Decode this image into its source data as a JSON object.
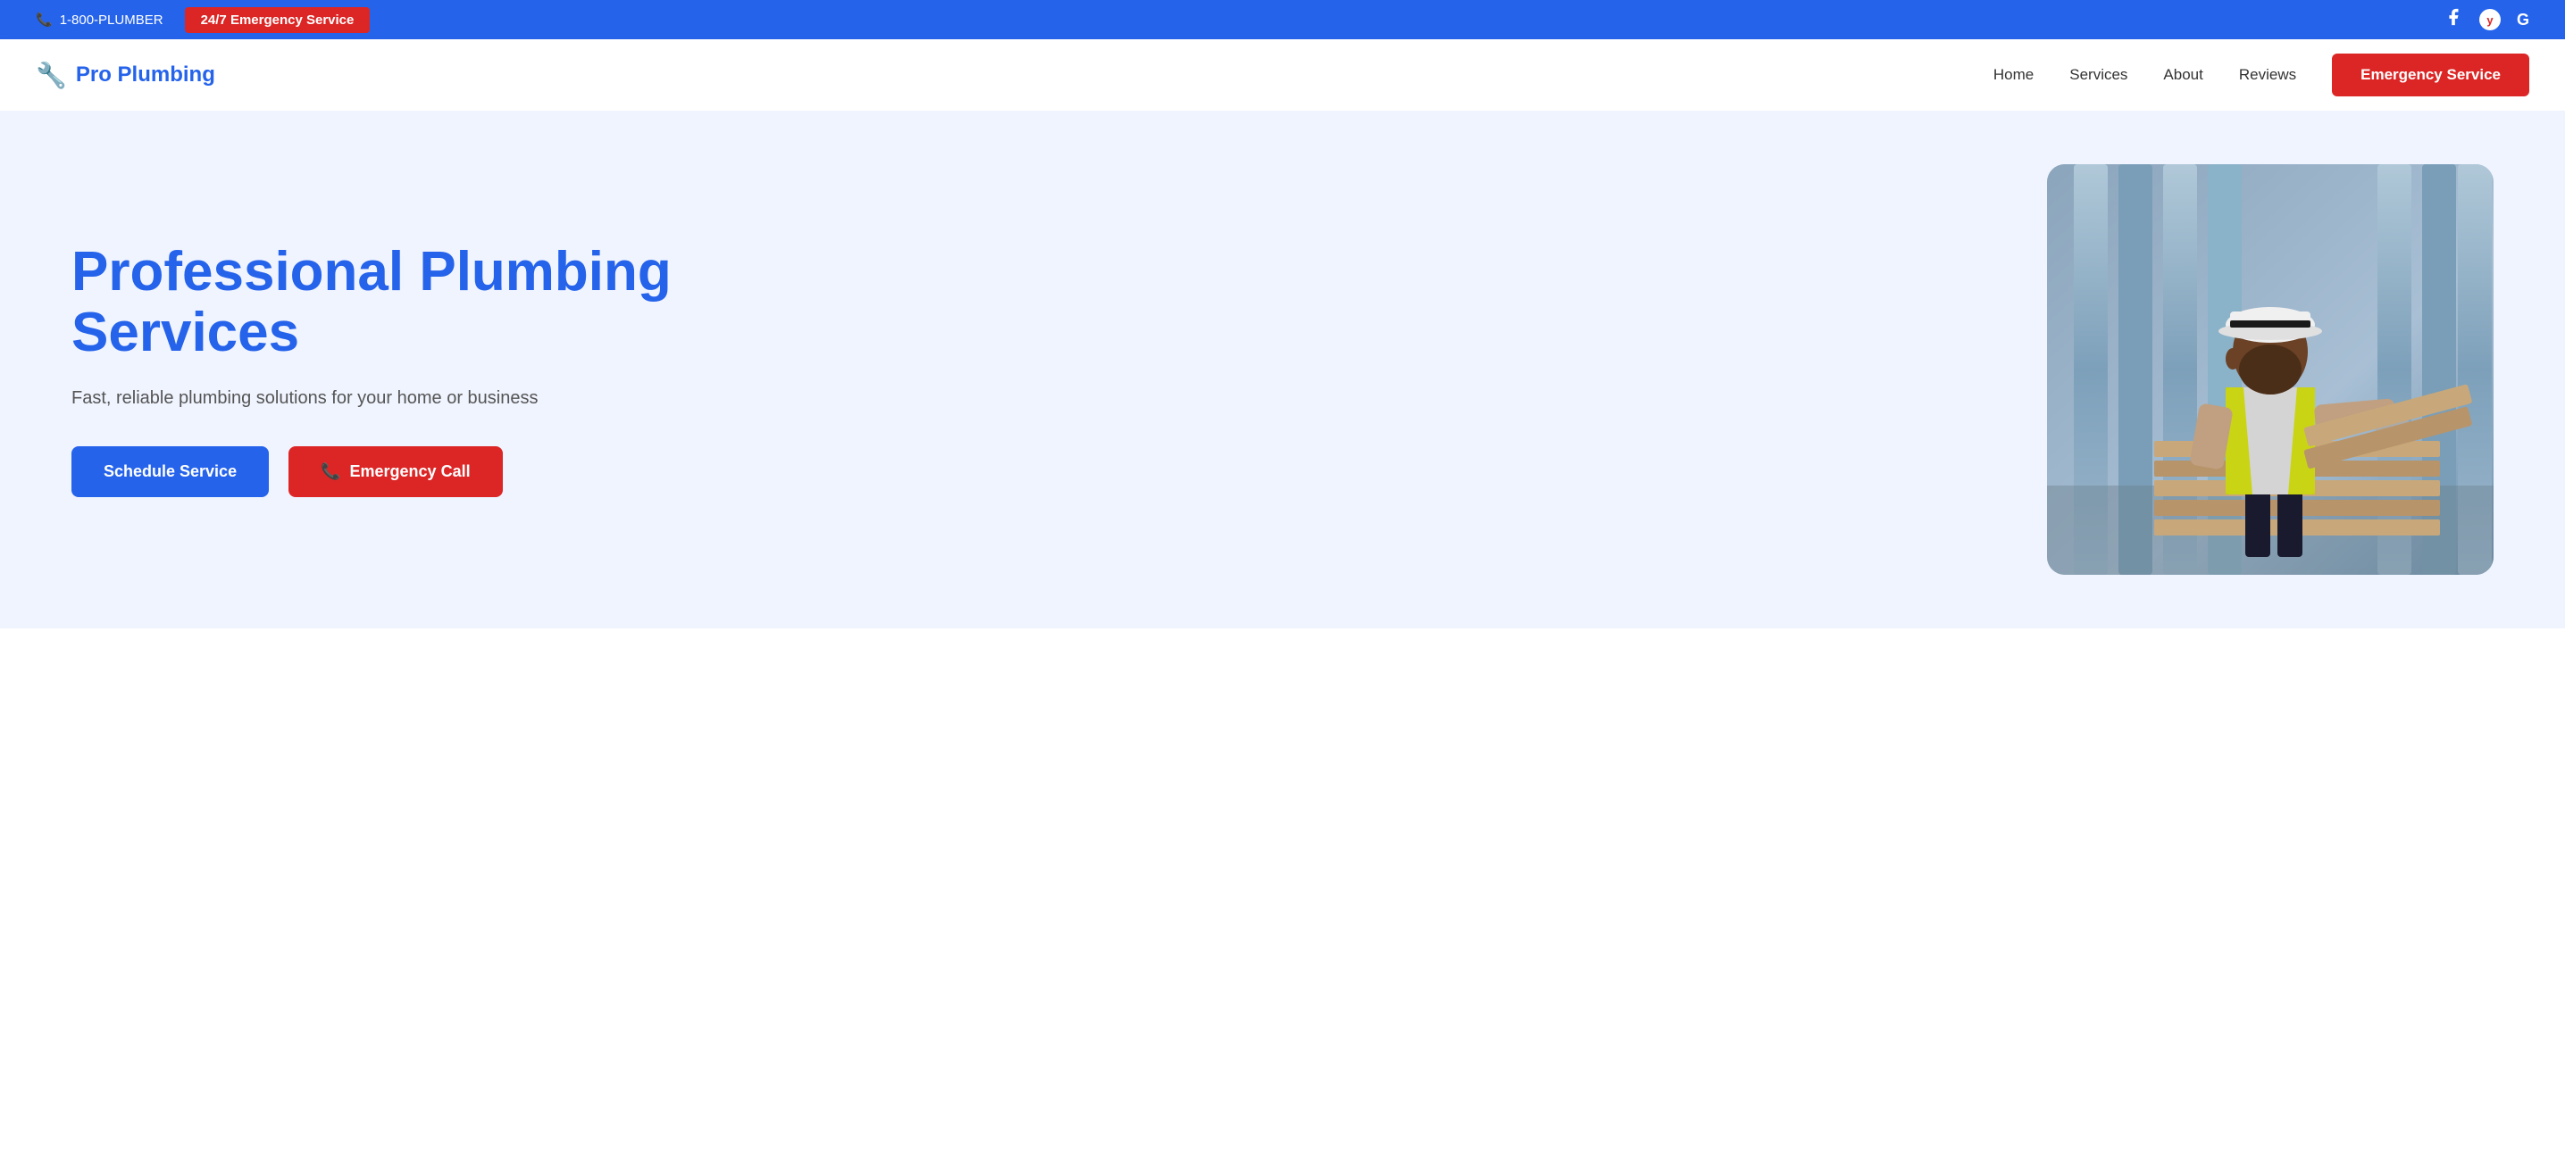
{
  "topbar": {
    "phone": "1-800-PLUMBER",
    "emergency_badge": "24/7 Emergency Service",
    "icons": [
      "facebook",
      "yelp",
      "google"
    ]
  },
  "navbar": {
    "logo_icon": "🔧",
    "logo_text": "Pro Plumbing",
    "links": [
      "Home",
      "Services",
      "About",
      "Reviews"
    ],
    "cta_label": "Emergency Service"
  },
  "hero": {
    "title_line1": "Professional Plumbing",
    "title_line2": "Services",
    "subtitle": "Fast, reliable plumbing solutions for your home or business",
    "btn_schedule": "Schedule Service",
    "btn_emergency": "Emergency Call",
    "phone_icon": "📞"
  }
}
